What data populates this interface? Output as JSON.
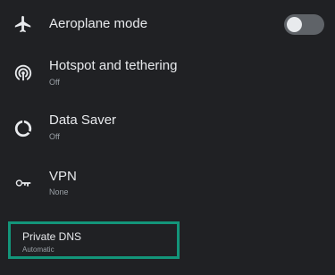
{
  "settings": {
    "airplane_mode": {
      "title": "Aeroplane mode",
      "icon": "airplane-icon",
      "toggle_on": false
    },
    "hotspot": {
      "title": "Hotspot and tethering",
      "subtitle": "Off",
      "icon": "hotspot-icon"
    },
    "data_saver": {
      "title": "Data Saver",
      "subtitle": "Off",
      "icon": "data-saver-icon"
    },
    "vpn": {
      "title": "VPN",
      "subtitle": "None",
      "icon": "vpn-key-icon"
    },
    "private_dns": {
      "title": "Private DNS",
      "subtitle": "Automatic"
    }
  },
  "colors": {
    "background": "#202124",
    "text_primary": "#e8eaed",
    "text_secondary": "#9aa0a6",
    "highlight_border": "#13957a",
    "toggle_track_off": "#5f6368"
  }
}
